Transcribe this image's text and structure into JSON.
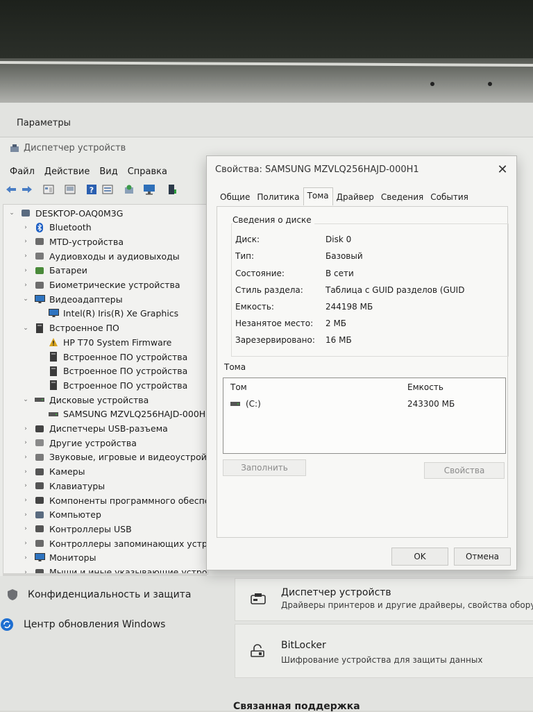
{
  "settings": {
    "title": "Параметры",
    "nav": [
      {
        "label": "Конфиденциальность и защита",
        "icon": "shield-icon"
      },
      {
        "label": "Центр обновления Windows",
        "icon": "update-icon"
      }
    ],
    "cards": [
      {
        "title": "Диспетчер устройств",
        "desc": "Драйверы принтеров и другие драйверы, свойства обору",
        "icon": "device-manager-icon"
      },
      {
        "title": "BitLocker",
        "desc": "Шифрование устройства для защиты данных",
        "icon": "bitlocker-icon"
      }
    ],
    "footer": "Связанная поддержка"
  },
  "device_manager": {
    "title": "Диспетчер устройств",
    "menu": [
      "Файл",
      "Действие",
      "Вид",
      "Справка"
    ],
    "toolbar": [
      "back-icon",
      "forward-icon",
      "properties-icon",
      "help-icon",
      "scan-icon",
      "monitor-icon",
      "driver-icon"
    ],
    "tree": [
      {
        "label": "DESKTOP-OAQ0M3G",
        "level": 0,
        "expanded": true,
        "icon": "computer-icon"
      },
      {
        "label": "Bluetooth",
        "level": 1,
        "expanded": false,
        "icon": "bluetooth-icon"
      },
      {
        "label": "MTD-устройства",
        "level": 1,
        "expanded": false,
        "icon": "mtd-icon"
      },
      {
        "label": "Аудиовходы и аудиовыходы",
        "level": 1,
        "expanded": false,
        "icon": "speaker-icon"
      },
      {
        "label": "Батареи",
        "level": 1,
        "expanded": false,
        "icon": "battery-icon"
      },
      {
        "label": "Биометрические устройства",
        "level": 1,
        "expanded": false,
        "icon": "biometric-icon"
      },
      {
        "label": "Видеоадаптеры",
        "level": 1,
        "expanded": true,
        "icon": "display-adapter-icon"
      },
      {
        "label": "Intel(R) Iris(R) Xe Graphics",
        "level": 2,
        "icon": "display-adapter-icon"
      },
      {
        "label": "Встроенное ПО",
        "level": 1,
        "expanded": true,
        "icon": "firmware-icon"
      },
      {
        "label": "HP T70 System Firmware",
        "level": 2,
        "icon": "firmware-warning-icon"
      },
      {
        "label": "Встроенное ПО устройства",
        "level": 2,
        "icon": "firmware-icon"
      },
      {
        "label": "Встроенное ПО устройства",
        "level": 2,
        "icon": "firmware-icon"
      },
      {
        "label": "Встроенное ПО устройства",
        "level": 2,
        "icon": "firmware-icon"
      },
      {
        "label": "Дисковые устройства",
        "level": 1,
        "expanded": true,
        "icon": "disk-icon"
      },
      {
        "label": "SAMSUNG MZVLQ256HAJD-000H",
        "level": 2,
        "icon": "disk-icon"
      },
      {
        "label": "Диспетчеры USB-разъема",
        "level": 1,
        "expanded": false,
        "icon": "usb-connector-icon"
      },
      {
        "label": "Другие устройства",
        "level": 1,
        "expanded": false,
        "icon": "unknown-device-icon"
      },
      {
        "label": "Звуковые, игровые и видеоустройст",
        "level": 1,
        "expanded": false,
        "icon": "sound-icon"
      },
      {
        "label": "Камеры",
        "level": 1,
        "expanded": false,
        "icon": "camera-icon"
      },
      {
        "label": "Клавиатуры",
        "level": 1,
        "expanded": false,
        "icon": "keyboard-icon"
      },
      {
        "label": "Компоненты программного обеспе",
        "level": 1,
        "expanded": false,
        "icon": "software-component-icon"
      },
      {
        "label": "Компьютер",
        "level": 1,
        "expanded": false,
        "icon": "computer-icon"
      },
      {
        "label": "Контроллеры USB",
        "level": 1,
        "expanded": false,
        "icon": "usb-icon"
      },
      {
        "label": "Контроллеры запоминающих устро",
        "level": 1,
        "expanded": false,
        "icon": "storage-controller-icon"
      },
      {
        "label": "Мониторы",
        "level": 1,
        "expanded": false,
        "icon": "monitor-icon"
      },
      {
        "label": "Мыши и иные указывающие устройства",
        "level": 1,
        "expanded": false,
        "icon": "mouse-icon"
      }
    ]
  },
  "dialog": {
    "title": "Свойства: SAMSUNG MZVLQ256HAJD-000H1",
    "tabs": [
      "Общие",
      "Политика",
      "Тома",
      "Драйвер",
      "Сведения",
      "События"
    ],
    "active_tab": "Тома",
    "disk_info_label": "Сведения о диске",
    "disk_info": [
      {
        "key": "Диск:",
        "value": "Disk 0"
      },
      {
        "key": "Тип:",
        "value": "Базовый"
      },
      {
        "key": "Состояние:",
        "value": "В сети"
      },
      {
        "key": "Стиль раздела:",
        "value": "Таблица с GUID разделов (GUID"
      },
      {
        "key": "Емкость:",
        "value": "244198 МБ"
      },
      {
        "key": "Незанятое место:",
        "value": "2 МБ"
      },
      {
        "key": "Зарезервировано:",
        "value": "16 МБ"
      }
    ],
    "volumes_label": "Тома",
    "volumes_columns": [
      "Том",
      "Емкость"
    ],
    "volumes": [
      {
        "volume": "(C:)",
        "capacity": "243300 МБ"
      }
    ],
    "populate_button": "Заполнить",
    "properties_button": "Свойства",
    "ok_button": "OK",
    "cancel_button": "Отмена"
  }
}
